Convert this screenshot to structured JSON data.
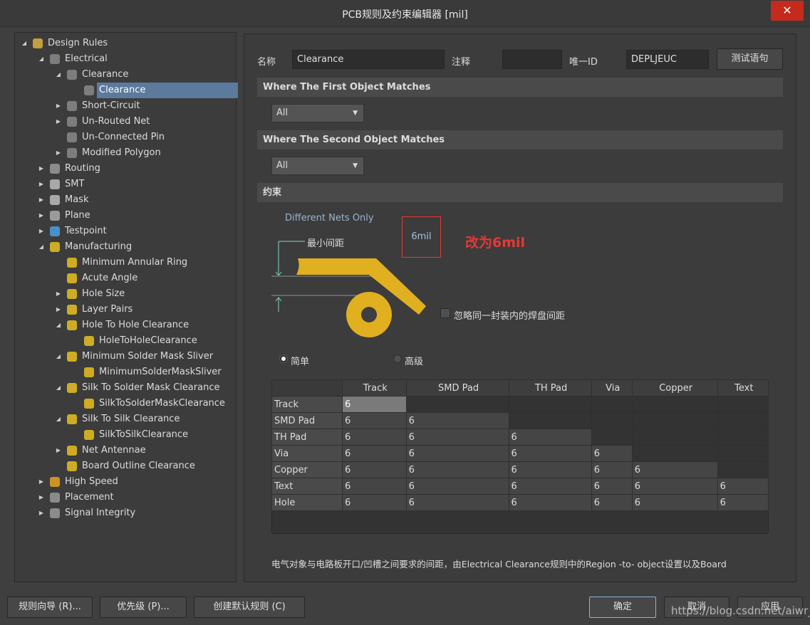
{
  "window": {
    "title": "PCB规则及约束编辑器 [mil]",
    "close_icon": "close-icon"
  },
  "tree": [
    {
      "label": "Design Rules",
      "level": 0,
      "expand": "open",
      "icon": "folder-rules-icon"
    },
    {
      "label": "Electrical",
      "level": 1,
      "expand": "open",
      "icon": "electrical-icon"
    },
    {
      "label": "Clearance",
      "level": 2,
      "expand": "open",
      "icon": "electrical-icon"
    },
    {
      "label": "Clearance",
      "level": 3,
      "expand": "none",
      "icon": "electrical-icon",
      "selected": true
    },
    {
      "label": "Short-Circuit",
      "level": 2,
      "expand": "closed",
      "icon": "electrical-icon"
    },
    {
      "label": "Un-Routed Net",
      "level": 2,
      "expand": "closed",
      "icon": "electrical-icon"
    },
    {
      "label": "Un-Connected Pin",
      "level": 2,
      "expand": "none",
      "icon": "electrical-icon"
    },
    {
      "label": "Modified Polygon",
      "level": 2,
      "expand": "closed",
      "icon": "electrical-icon"
    },
    {
      "label": "Routing",
      "level": 1,
      "expand": "closed",
      "icon": "routing-icon"
    },
    {
      "label": "SMT",
      "level": 1,
      "expand": "closed",
      "icon": "smt-icon"
    },
    {
      "label": "Mask",
      "level": 1,
      "expand": "closed",
      "icon": "mask-icon"
    },
    {
      "label": "Plane",
      "level": 1,
      "expand": "closed",
      "icon": "plane-icon"
    },
    {
      "label": "Testpoint",
      "level": 1,
      "expand": "closed",
      "icon": "testpoint-icon"
    },
    {
      "label": "Manufacturing",
      "level": 1,
      "expand": "open",
      "icon": "manufacturing-icon"
    },
    {
      "label": "Minimum Annular Ring",
      "level": 2,
      "expand": "none",
      "icon": "manufacturing-icon"
    },
    {
      "label": "Acute Angle",
      "level": 2,
      "expand": "none",
      "icon": "manufacturing-icon"
    },
    {
      "label": "Hole Size",
      "level": 2,
      "expand": "closed",
      "icon": "manufacturing-icon"
    },
    {
      "label": "Layer Pairs",
      "level": 2,
      "expand": "closed",
      "icon": "manufacturing-icon"
    },
    {
      "label": "Hole To Hole Clearance",
      "level": 2,
      "expand": "open",
      "icon": "manufacturing-icon"
    },
    {
      "label": "HoleToHoleClearance",
      "level": 3,
      "expand": "none",
      "icon": "manufacturing-icon"
    },
    {
      "label": "Minimum Solder Mask Sliver",
      "level": 2,
      "expand": "open",
      "icon": "manufacturing-icon"
    },
    {
      "label": "MinimumSolderMaskSliver",
      "level": 3,
      "expand": "none",
      "icon": "manufacturing-icon"
    },
    {
      "label": "Silk To Solder Mask Clearance",
      "level": 2,
      "expand": "open",
      "icon": "manufacturing-icon"
    },
    {
      "label": "SilkToSolderMaskClearance",
      "level": 3,
      "expand": "none",
      "icon": "manufacturing-icon"
    },
    {
      "label": "Silk To Silk Clearance",
      "level": 2,
      "expand": "open",
      "icon": "manufacturing-icon"
    },
    {
      "label": "SilkToSilkClearance",
      "level": 3,
      "expand": "none",
      "icon": "manufacturing-icon"
    },
    {
      "label": "Net Antennae",
      "level": 2,
      "expand": "closed",
      "icon": "manufacturing-icon"
    },
    {
      "label": "Board Outline Clearance",
      "level": 2,
      "expand": "none",
      "icon": "manufacturing-icon"
    },
    {
      "label": "High Speed",
      "level": 1,
      "expand": "closed",
      "icon": "highspeed-icon"
    },
    {
      "label": "Placement",
      "level": 1,
      "expand": "closed",
      "icon": "placement-icon"
    },
    {
      "label": "Signal Integrity",
      "level": 1,
      "expand": "closed",
      "icon": "signal-integrity-icon"
    }
  ],
  "form": {
    "name_label": "名称",
    "name_value": "Clearance",
    "comment_label": "注释",
    "comment_value": "",
    "uid_label": "唯一ID",
    "uid_value": "DEPLJEUC",
    "test_button": "测试语句"
  },
  "first_match": {
    "title": "Where The First Object Matches",
    "value": "All"
  },
  "second_match": {
    "title": "Where The Second Object Matches",
    "value": "All"
  },
  "constraints": {
    "title": "约束",
    "net_scope": "Different Nets Only",
    "min_clearance_label": "最小间距",
    "min_clearance_value": "6mil",
    "annotation": "改为6mil",
    "annotation_color": "#e53935",
    "ignore_pad_label": "忽略同一封装内的焊盘间距",
    "ignore_pad_checked": false,
    "mode_simple": "简单",
    "mode_advanced": "高级",
    "mode_selected": "simple",
    "copper_color": "#e0b020"
  },
  "matrix": {
    "columns": [
      "Track",
      "SMD Pad",
      "TH Pad",
      "Via",
      "Copper",
      "Text"
    ],
    "rows": [
      {
        "label": "Track",
        "values": [
          "6",
          "",
          "",
          "",
          "",
          ""
        ]
      },
      {
        "label": "SMD Pad",
        "values": [
          "6",
          "6",
          "",
          "",
          "",
          ""
        ]
      },
      {
        "label": "TH Pad",
        "values": [
          "6",
          "6",
          "6",
          "",
          "",
          ""
        ]
      },
      {
        "label": "Via",
        "values": [
          "6",
          "6",
          "6",
          "6",
          "",
          ""
        ]
      },
      {
        "label": "Copper",
        "values": [
          "6",
          "6",
          "6",
          "6",
          "6",
          ""
        ]
      },
      {
        "label": "Text",
        "values": [
          "6",
          "6",
          "6",
          "6",
          "6",
          "6"
        ]
      },
      {
        "label": "Hole",
        "values": [
          "6",
          "6",
          "6",
          "6",
          "6",
          "6"
        ]
      }
    ]
  },
  "description": "电气对象与电路板开口/凹槽之间要求的间距，由Electrical Clearance规则中的Region -to- object设置以及Board",
  "footer": {
    "wizard": "规则向导 (R)...",
    "priority": "优先级 (P)...",
    "create_default": "创建默认规则 (C)",
    "ok": "确定",
    "cancel": "取消",
    "apply": "应用"
  },
  "watermark": "https://blog.csdn.net/aiwr_"
}
